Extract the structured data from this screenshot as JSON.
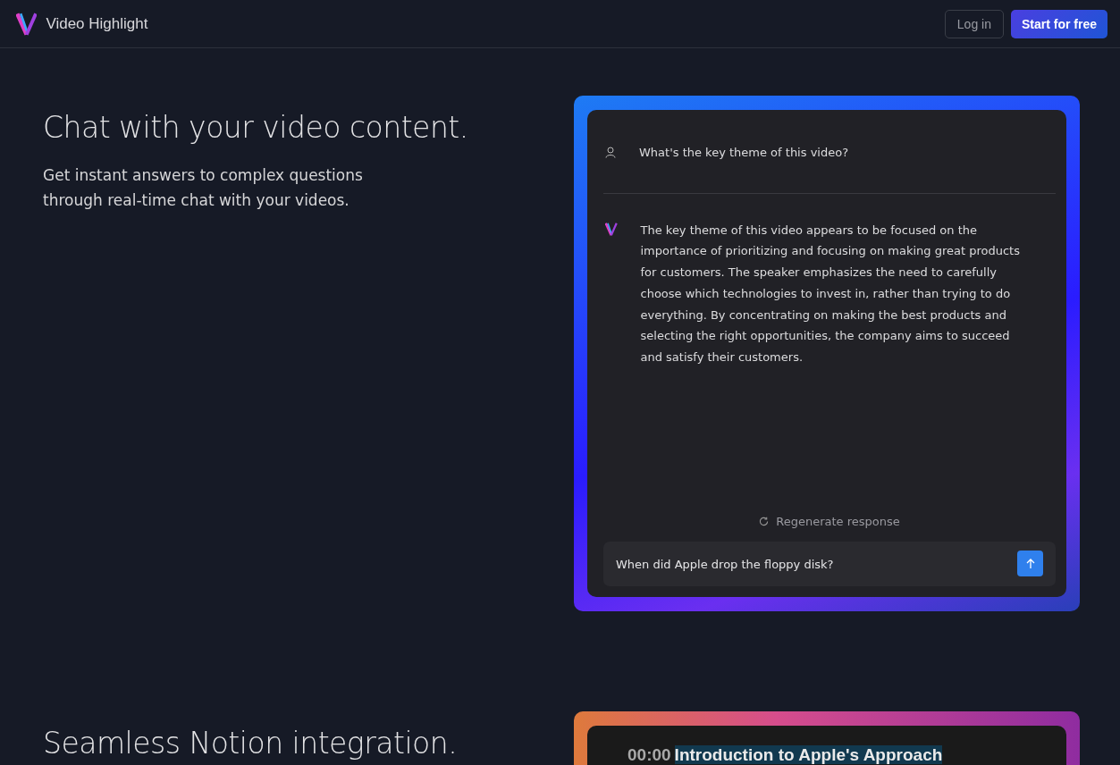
{
  "header": {
    "brand": "Video Highlight",
    "login": "Log in",
    "cta": "Start for free"
  },
  "sections": [
    {
      "kind": "chat",
      "title": "Chat with your video content.",
      "subtitle": "Get instant answers to complex questions through real-time chat with your videos.",
      "chat": {
        "question": "What's the key theme of this video?",
        "answer": "The key theme of this video appears to be focused on the importance of prioritizing and focusing on making great products for customers. The speaker emphasizes the need to carefully choose which technologies to invest in, rather than trying to do everything. By concentrating on making the best products and selecting the right opportunities, the company aims to succeed and satisfy their customers.",
        "regenerate": "Regenerate response",
        "input_value": "When did Apple drop the floppy disk?"
      }
    },
    {
      "kind": "notion",
      "title": "Seamless Notion integration.",
      "notion": {
        "timestamp": "00:00",
        "heading": "Introduction to Apple's Approach"
      }
    }
  ]
}
